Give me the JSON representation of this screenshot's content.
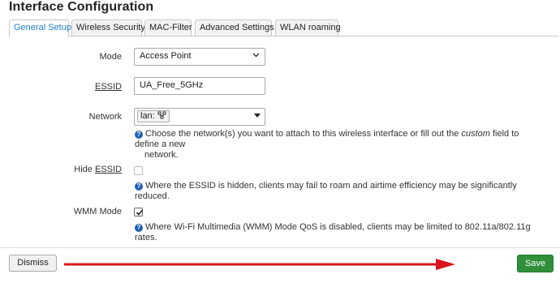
{
  "page_title": "Interface Configuration",
  "tabs": [
    {
      "label": "General Setup",
      "active": true
    },
    {
      "label": "Wireless Security",
      "active": false
    },
    {
      "label": "MAC-Filter",
      "active": false
    },
    {
      "label": "Advanced Settings",
      "active": false
    },
    {
      "label": "WLAN roaming",
      "active": false
    }
  ],
  "form": {
    "mode": {
      "label": "Mode",
      "value": "Access Point"
    },
    "essid": {
      "label": "ESSID",
      "value": "UA_Free_5GHz"
    },
    "network": {
      "label": "Network",
      "selected": "lan:",
      "help_before": "Choose the network(s) you want to attach to this wireless interface or fill out the ",
      "help_em": "custom",
      "help_after": " field to define a new",
      "help_line2": "network."
    },
    "hide_essid": {
      "label_prefix": "Hide ",
      "label_underlined": "ESSID",
      "checked": false,
      "help": "Where the ESSID is hidden, clients may fail to roam and airtime efficiency may be significantly reduced."
    },
    "wmm_mode": {
      "label": "WMM Mode",
      "checked": true,
      "help": "Where Wi-Fi Multimedia (WMM) Mode QoS is disabled, clients may be limited to 802.11a/802.11g rates."
    }
  },
  "footer": {
    "dismiss_label": "Dismiss",
    "save_label": "Save"
  },
  "icons": {
    "help": "question-circle-icon",
    "select_chevron": "chevron-down-icon",
    "dropdown_triangle": "triangle-down-icon",
    "network": "network-icon",
    "check": "check-icon"
  },
  "colors": {
    "active_tab_text": "#1f7fcf",
    "save_button": "#2f8f3a",
    "help_icon": "#1f5fb4",
    "annotation_arrow": "#d9141a"
  }
}
